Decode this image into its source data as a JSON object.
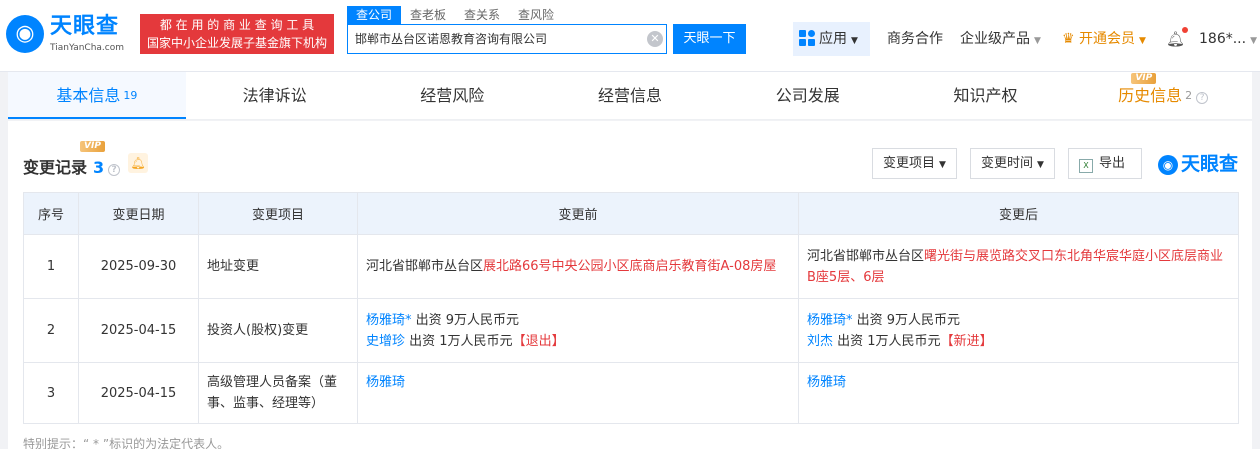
{
  "header": {
    "logo_cn": "天眼查",
    "logo_en": "TianYanCha.com",
    "slogan_line1": "都 在 用 的 商 业 查 询 工 具",
    "slogan_line2": "国家中小企业发展子基金旗下机构",
    "search_tabs": [
      "查公司",
      "查老板",
      "查关系",
      "查风险"
    ],
    "search_value": "邯郸市丛台区诺恩教育咨询有限公司",
    "search_button": "天眼一下",
    "apps_label": "应用",
    "nav_business": "商务合作",
    "nav_enterprise": "企业级产品",
    "nav_vip": "开通会员",
    "user_label": "186*..."
  },
  "tabs": [
    {
      "label": "基本信息",
      "count": "19"
    },
    {
      "label": "法律诉讼"
    },
    {
      "label": "经营风险"
    },
    {
      "label": "经营信息"
    },
    {
      "label": "公司发展"
    },
    {
      "label": "知识产权"
    },
    {
      "label": "历史信息",
      "count": "2",
      "vip": "VIP"
    }
  ],
  "section": {
    "title": "变更记录",
    "count": "3",
    "vip_badge": "VIP",
    "filter_item": "变更项目",
    "filter_time": "变更时间",
    "export_label": "导出",
    "brand_logo": "天眼查"
  },
  "table": {
    "headers": [
      "序号",
      "变更日期",
      "变更项目",
      "变更前",
      "变更后"
    ],
    "rows": [
      {
        "no": "1",
        "date": "2025-09-30",
        "item": "地址变更",
        "before_plain": "河北省邯郸市丛台区",
        "before_red": "展北路66号中央公园小区底商启乐教育街A-08房屋",
        "after_plain": "河北省邯郸市丛台区",
        "after_red": "曙光街与展览路交叉口东北角华宸华庭小区底层商业B座5层、6层"
      },
      {
        "no": "2",
        "date": "2025-04-15",
        "item": "投资人(股权)变更",
        "before_l1_name": "杨雅琦*",
        "before_l1_text": " 出资 9万人民币元",
        "before_l2_name": "史增珍",
        "before_l2_text": " 出资 1万人民币元",
        "before_l2_tag": "【退出】",
        "after_l1_name": "杨雅琦*",
        "after_l1_text": " 出资 9万人民币元",
        "after_l2_name": "刘杰",
        "after_l2_text": " 出资 1万人民币元",
        "after_l2_tag": "【新进】"
      },
      {
        "no": "3",
        "date": "2025-04-15",
        "item": "高级管理人员备案（董事、监事、经理等）",
        "before_name": "杨雅琦",
        "after_name": "杨雅琦"
      }
    ]
  },
  "note": "特别提示：“ * ”标识的为法定代表人。"
}
